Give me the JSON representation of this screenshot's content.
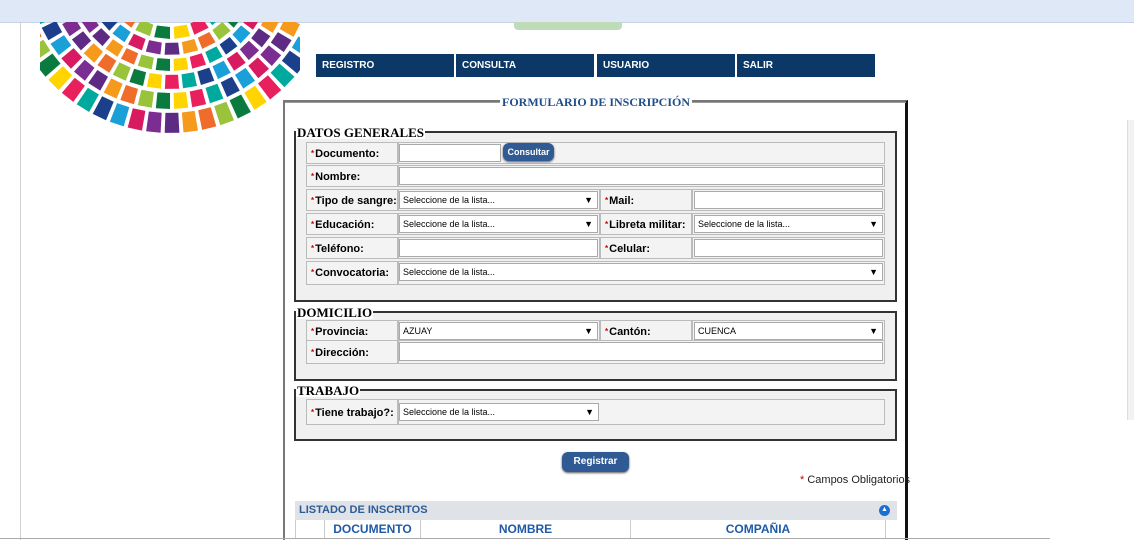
{
  "nav": [
    {
      "label": "REGISTRO"
    },
    {
      "label": "CONSULTA"
    },
    {
      "label": "USUARIO"
    },
    {
      "label": "SALIR"
    }
  ],
  "form_title": "FORMULARIO DE INSCRIPCIÓN",
  "sections": {
    "datos_generales": "DATOS GENERALES",
    "domicilio": "DOMICILIO",
    "trabajo": "TRABAJO"
  },
  "fields": {
    "documento": "Documento:",
    "nombre": "Nombre:",
    "tipo_sangre": "Tipo de sangre:",
    "mail": "Mail:",
    "educacion": "Educación:",
    "libreta_militar": "Libreta militar:",
    "telefono": "Teléfono:",
    "celular": "Celular:",
    "convocatoria": "Convocatoria:",
    "provincia": "Provincia:",
    "canton": "Cantón:",
    "direccion": "Dirección:",
    "tiene_trabajo": "Tiene trabajo?:"
  },
  "selects": {
    "placeholder": "Seleccione de la lista...",
    "provincia_value": "AZUAY",
    "canton_value": "CUENCA"
  },
  "buttons": {
    "consultar": "Consultar",
    "registrar": "Registrar"
  },
  "required_note": "Campos Obligatorios",
  "listado": {
    "title": "LISTADO DE INSCRITOS",
    "columns": [
      "DOCUMENTO",
      "NOMBRE",
      "COMPAÑIA"
    ]
  }
}
